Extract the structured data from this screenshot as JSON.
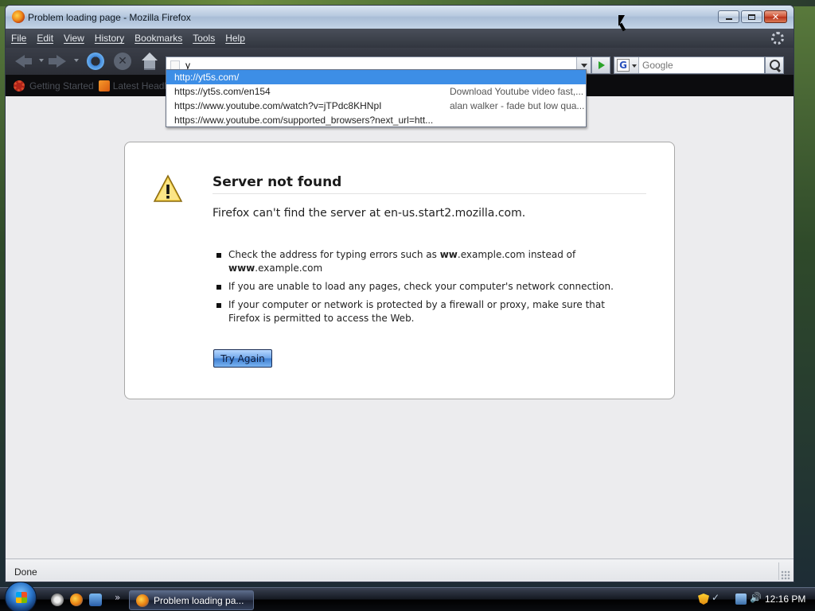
{
  "window": {
    "title": "Problem loading page - Mozilla Firefox"
  },
  "menu": [
    "File",
    "Edit",
    "View",
    "History",
    "Bookmarks",
    "Tools",
    "Help"
  ],
  "nav": {
    "url_value": "y",
    "search_placeholder": "Google",
    "search_engine": "G"
  },
  "autocomplete": [
    {
      "url": "http://yt5s.com/",
      "title": "",
      "selected": true
    },
    {
      "url": "https://yt5s.com/en154",
      "title": "Download Youtube video fast,...",
      "selected": false
    },
    {
      "url": "https://www.youtube.com/watch?v=jTPdc8KHNpI",
      "title": "alan walker - fade but low qua...",
      "selected": false
    },
    {
      "url": "https://www.youtube.com/supported_browsers?next_url=htt...",
      "title": "",
      "selected": false
    }
  ],
  "bookmarks": [
    {
      "label": "Getting Started",
      "icon": "gear-icon"
    },
    {
      "label": "Latest Headlines",
      "icon": "rss-icon"
    }
  ],
  "error": {
    "title": "Server not found",
    "description": "Firefox can't find the server at en-us.start2.mozilla.com.",
    "suggestions": {
      "s1_pre": "Check the address for typing errors such as ",
      "s1_bold1": "ww",
      "s1_mid": ".example.com instead of",
      "s1_bold2": "www",
      "s1_post": ".example.com",
      "s2": "If you are unable to load any pages, check your computer's network connection.",
      "s3": "If your computer or network is protected by a firewall or proxy, make sure that Firefox is permitted to access the Web."
    },
    "button": "Try Again"
  },
  "status": {
    "text": "Done"
  },
  "taskbar": {
    "more": "»",
    "task_label": "Problem loading pa...",
    "clock": "12:16 PM"
  },
  "colors": {
    "selected_row": "#3d8ee6",
    "menubar": "#32363f",
    "page_bg": "#ececee"
  }
}
